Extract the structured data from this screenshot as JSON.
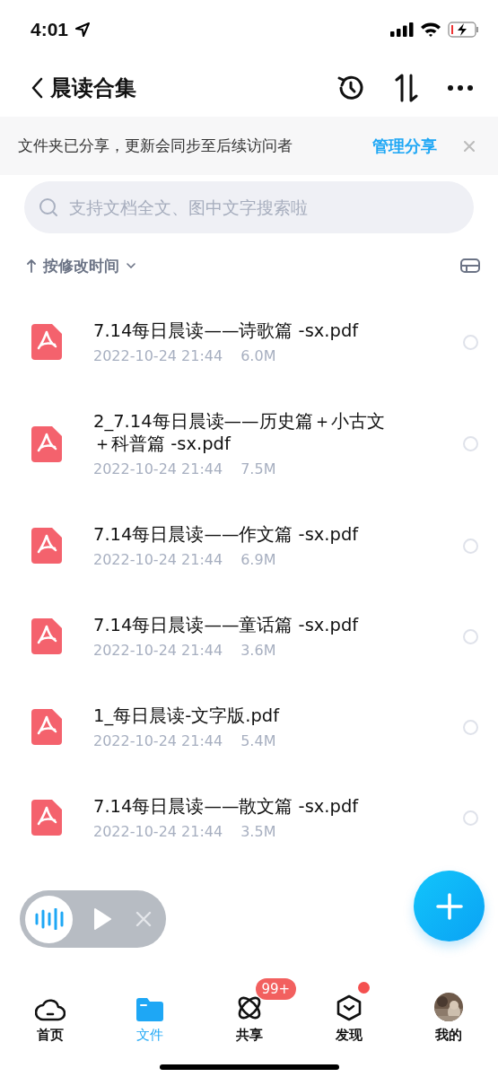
{
  "status_bar": {
    "time": "4:01"
  },
  "nav": {
    "title": "晨读合集"
  },
  "banner": {
    "text": "文件夹已分享，更新会同步至后续访问者",
    "action": "管理分享"
  },
  "search": {
    "placeholder": "支持文档全文、图中文字搜索啦"
  },
  "sort": {
    "label": "按修改时间"
  },
  "files": [
    {
      "name": "7.14每日晨读——诗歌篇 -sx.pdf",
      "date": "2022-10-24 21:44",
      "size": "6.0M",
      "selected": false
    },
    {
      "name": "2_7.14每日晨读——历史篇＋小古文＋科普篇 -sx.pdf",
      "date": "2022-10-24 21:44",
      "size": "7.5M",
      "selected": false
    },
    {
      "name": "7.14每日晨读——作文篇 -sx.pdf",
      "date": "2022-10-24 21:44",
      "size": "6.9M",
      "selected": false
    },
    {
      "name": "7.14每日晨读——童话篇 -sx.pdf",
      "date": "2022-10-24 21:44",
      "size": "3.6M",
      "selected": false
    },
    {
      "name": "1_每日晨读-文字版.pdf",
      "date": "2022-10-24 21:44",
      "size": "5.4M",
      "selected": false
    },
    {
      "name": "7.14每日晨读——散文篇 -sx.pdf",
      "date": "2022-10-24 21:44",
      "size": "3.5M",
      "selected": false
    }
  ],
  "tab_bar": [
    {
      "kind": "home",
      "label": "首页",
      "selected": false
    },
    {
      "kind": "files",
      "label": "文件",
      "selected": true
    },
    {
      "kind": "share",
      "label": "共享",
      "selected": false,
      "badge": "99+"
    },
    {
      "kind": "discover",
      "label": "发现",
      "selected": false,
      "dot": true
    },
    {
      "kind": "me",
      "label": "我的",
      "selected": false
    }
  ]
}
